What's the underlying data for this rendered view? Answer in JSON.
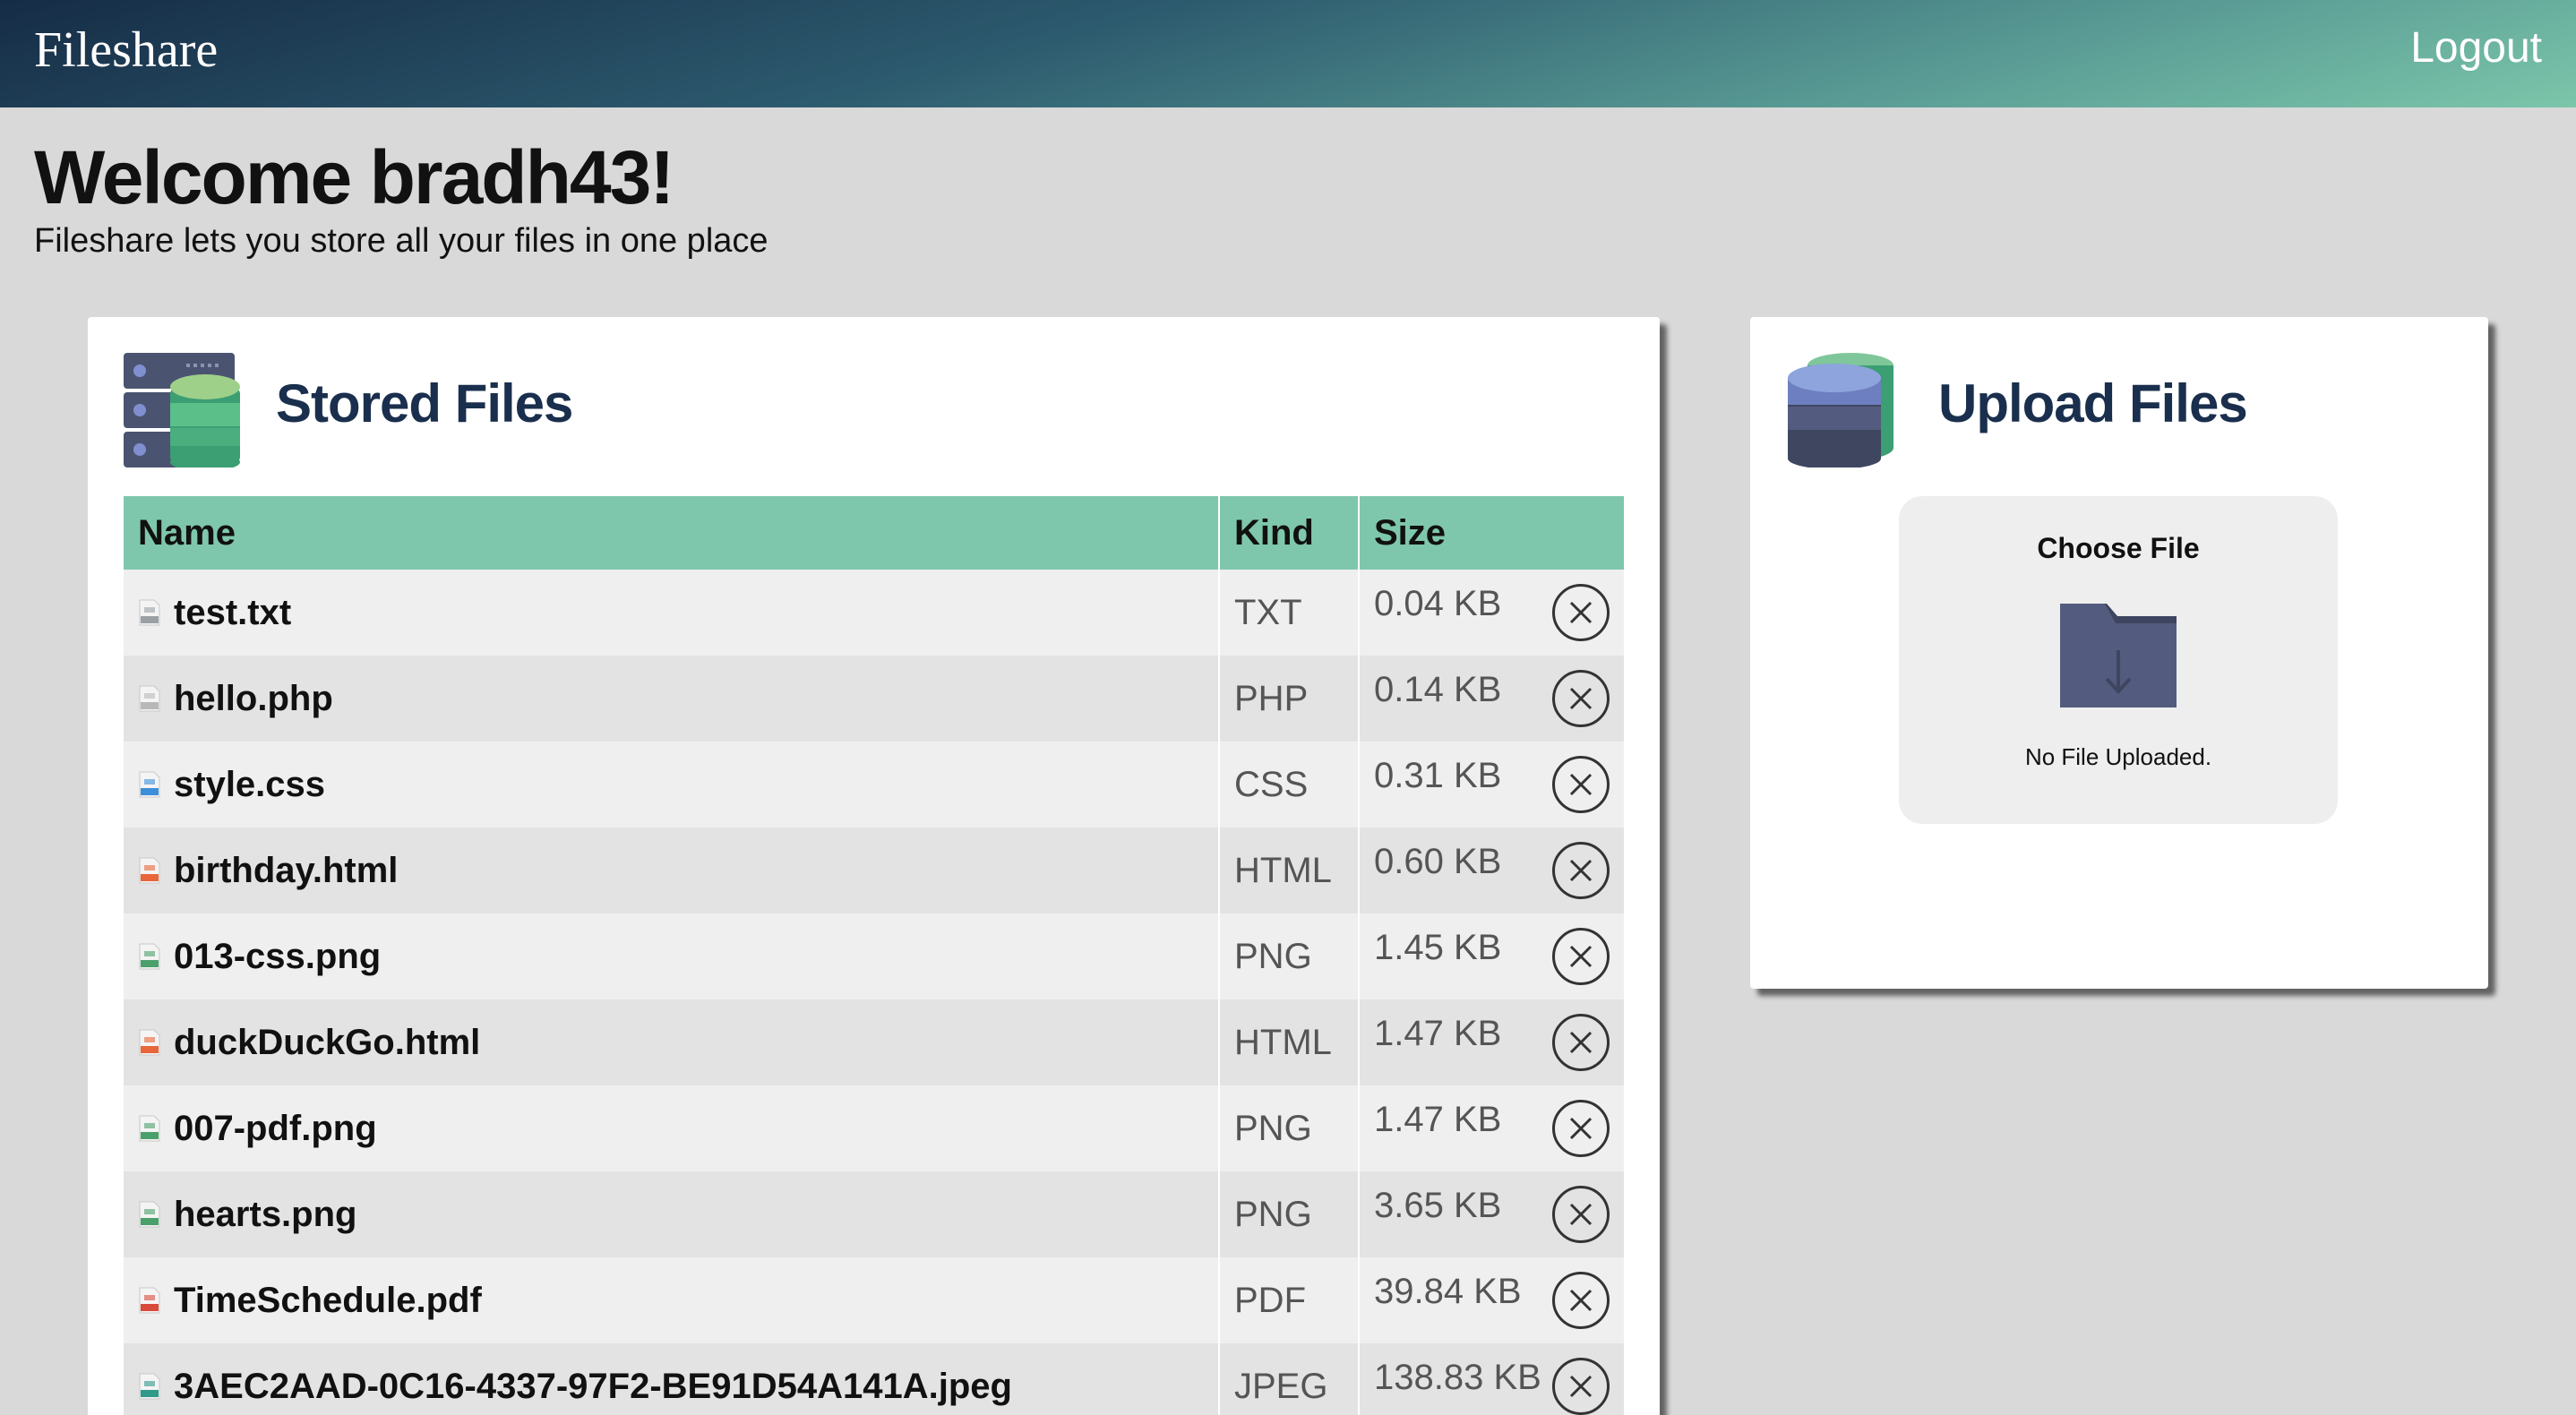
{
  "header": {
    "brand": "Fileshare",
    "logout_label": "Logout"
  },
  "greeting": {
    "title": "Welcome bradh43!",
    "subtitle": "Fileshare lets you store all your files in one place"
  },
  "stored": {
    "title": "Stored Files",
    "columns": {
      "name": "Name",
      "kind": "Kind",
      "size": "Size"
    },
    "files": [
      {
        "name": "test.txt",
        "kind": "TXT",
        "size": "0.04 KB",
        "icon": "txt-file-icon"
      },
      {
        "name": "hello.php",
        "kind": "PHP",
        "size": "0.14 KB",
        "icon": "php-file-icon"
      },
      {
        "name": "style.css",
        "kind": "CSS",
        "size": "0.31 KB",
        "icon": "css-file-icon"
      },
      {
        "name": "birthday.html",
        "kind": "HTML",
        "size": "0.60 KB",
        "icon": "html-file-icon"
      },
      {
        "name": "013-css.png",
        "kind": "PNG",
        "size": "1.45 KB",
        "icon": "png-file-icon"
      },
      {
        "name": "duckDuckGo.html",
        "kind": "HTML",
        "size": "1.47 KB",
        "icon": "html-file-icon"
      },
      {
        "name": "007-pdf.png",
        "kind": "PNG",
        "size": "1.47 KB",
        "icon": "png-file-icon"
      },
      {
        "name": "hearts.png",
        "kind": "PNG",
        "size": "3.65 KB",
        "icon": "png-file-icon"
      },
      {
        "name": "TimeSchedule.pdf",
        "kind": "PDF",
        "size": "39.84 KB",
        "icon": "pdf-file-icon"
      },
      {
        "name": "3AEC2AAD-0C16-4337-97F2-BE91D54A141A.jpeg",
        "kind": "JPEG",
        "size": "138.83 KB",
        "icon": "jpeg-file-icon"
      }
    ]
  },
  "upload": {
    "title": "Upload Files",
    "choose_label": "Choose File",
    "status": "No File Uploaded."
  },
  "colors": {
    "table_header": "#7fc7ac",
    "title_navy": "#1a2f4d",
    "page_bg": "#d9d9d9",
    "row_light": "#efefef",
    "row_dark": "#e3e3e3"
  }
}
